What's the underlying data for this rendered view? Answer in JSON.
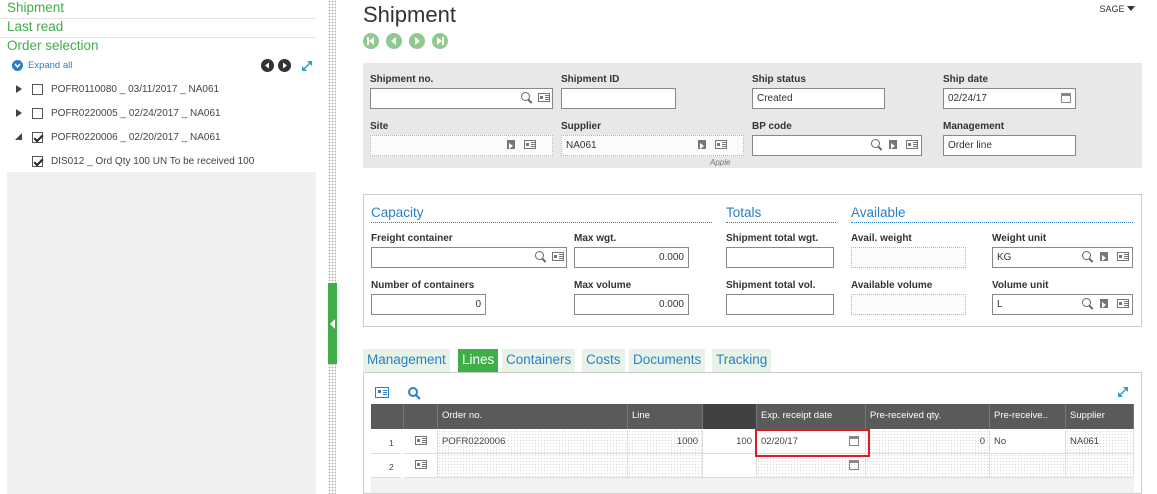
{
  "left_panel": {
    "links": [
      "Shipment",
      "Last read",
      "Order selection"
    ],
    "expand_all": "Expand all",
    "tree": [
      {
        "label": "POFR0110080 _ 03/11/2017 _ NA061",
        "expanded": false,
        "checked": false
      },
      {
        "label": "POFR0220005 _ 02/24/2017 _ NA061",
        "expanded": false,
        "checked": false
      },
      {
        "label": "POFR0220006 _ 02/20/2017 _ NA061",
        "expanded": true,
        "checked": true
      },
      {
        "label": "DIS012 _ Ord Qty 100 UN To be received 100",
        "expanded": false,
        "checked": true
      }
    ]
  },
  "header": {
    "title": "Shipment",
    "user": "SAGE"
  },
  "form": {
    "shipment_no": {
      "label": "Shipment no.",
      "value": ""
    },
    "shipment_id": {
      "label": "Shipment ID",
      "value": ""
    },
    "ship_status": {
      "label": "Ship status",
      "value": "Created"
    },
    "ship_date": {
      "label": "Ship date",
      "value": "02/24/17"
    },
    "site": {
      "label": "Site",
      "value": ""
    },
    "supplier": {
      "label": "Supplier",
      "value": "NA061",
      "subtext": "Apple"
    },
    "bp_code": {
      "label": "BP code",
      "value": ""
    },
    "management": {
      "label": "Management",
      "value": "Order line"
    }
  },
  "capacity": {
    "section_capacity": "Capacity",
    "section_totals": "Totals",
    "section_available": "Available",
    "freight_container": {
      "label": "Freight container",
      "value": ""
    },
    "max_wgt": {
      "label": "Max wgt.",
      "value": "0.000"
    },
    "shipment_total_wgt": {
      "label": "Shipment total wgt.",
      "value": ""
    },
    "avail_weight": {
      "label": "Avail. weight",
      "value": ""
    },
    "weight_unit": {
      "label": "Weight unit",
      "value": "KG"
    },
    "number_of_containers": {
      "label": "Number of containers",
      "value": "0"
    },
    "max_volume": {
      "label": "Max volume",
      "value": "0.000"
    },
    "shipment_total_vol": {
      "label": "Shipment total vol.",
      "value": ""
    },
    "available_volume": {
      "label": "Available volume",
      "value": ""
    },
    "volume_unit": {
      "label": "Volume unit",
      "value": "L"
    }
  },
  "tabs": [
    "Management",
    "Lines",
    "Containers",
    "Costs",
    "Documents",
    "Tracking"
  ],
  "active_tab": "Lines",
  "grid": {
    "columns": [
      "",
      "Order no.",
      "Line",
      "",
      "Exp. receipt date",
      "Pre-received qty.",
      "Pre-receive..",
      "Supplier"
    ],
    "rows": [
      {
        "num": "1",
        "order_no": "POFR0220006",
        "line": "1000",
        "qty": "100",
        "exp_date": "02/20/17",
        "pre_qty": "0",
        "pre_recv": "No",
        "supplier": "NA061"
      },
      {
        "num": "2",
        "order_no": "",
        "line": "",
        "qty": "",
        "exp_date": "",
        "pre_qty": "",
        "pre_recv": "",
        "supplier": ""
      }
    ]
  },
  "colors": {
    "green": "#3fae49",
    "blue": "#2a7fc6",
    "highlight": "#e01b24"
  }
}
